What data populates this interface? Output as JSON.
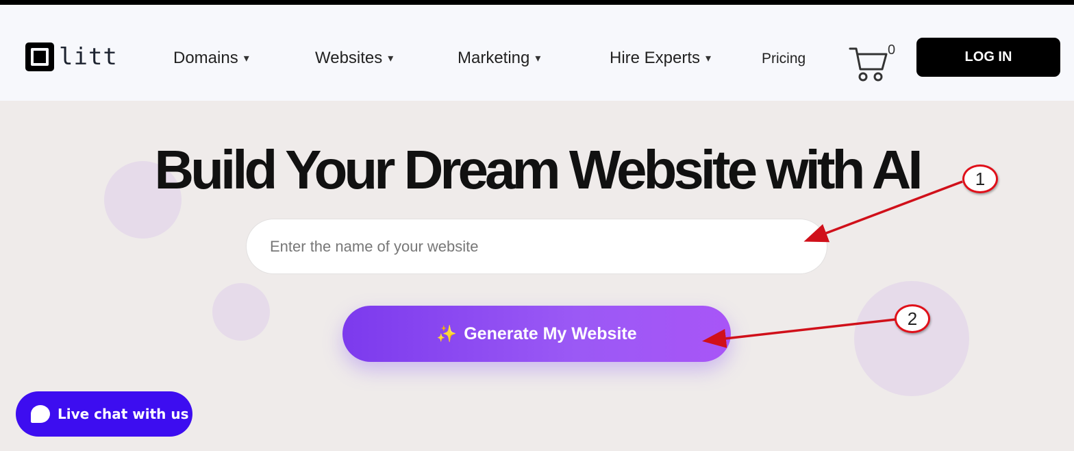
{
  "brand": {
    "name": "litt"
  },
  "nav": {
    "items": [
      {
        "label": "Domains",
        "caret": "▾"
      },
      {
        "label": "Websites",
        "caret": "▾"
      },
      {
        "label": "Marketing",
        "caret": "▾"
      },
      {
        "label": "Hire Experts",
        "caret": "▾"
      }
    ],
    "pricing": "Pricing"
  },
  "cart": {
    "count": "0"
  },
  "login": {
    "label": "LOG IN"
  },
  "hero": {
    "title": "Build Your Dream Website with AI",
    "input_placeholder": "Enter the name of your website",
    "input_value": "",
    "generate_sparkle": "✨",
    "generate_label": "Generate My Website"
  },
  "chat": {
    "label": "Live chat with us"
  },
  "annotations": [
    {
      "number": "1"
    },
    {
      "number": "2"
    }
  ],
  "colors": {
    "page_bg": "#efebea",
    "header_bg": "#f7f8fc",
    "accent_purple": "#7c3aed",
    "chat_blue": "#3d0df0",
    "annotation_red": "#e0101a"
  }
}
